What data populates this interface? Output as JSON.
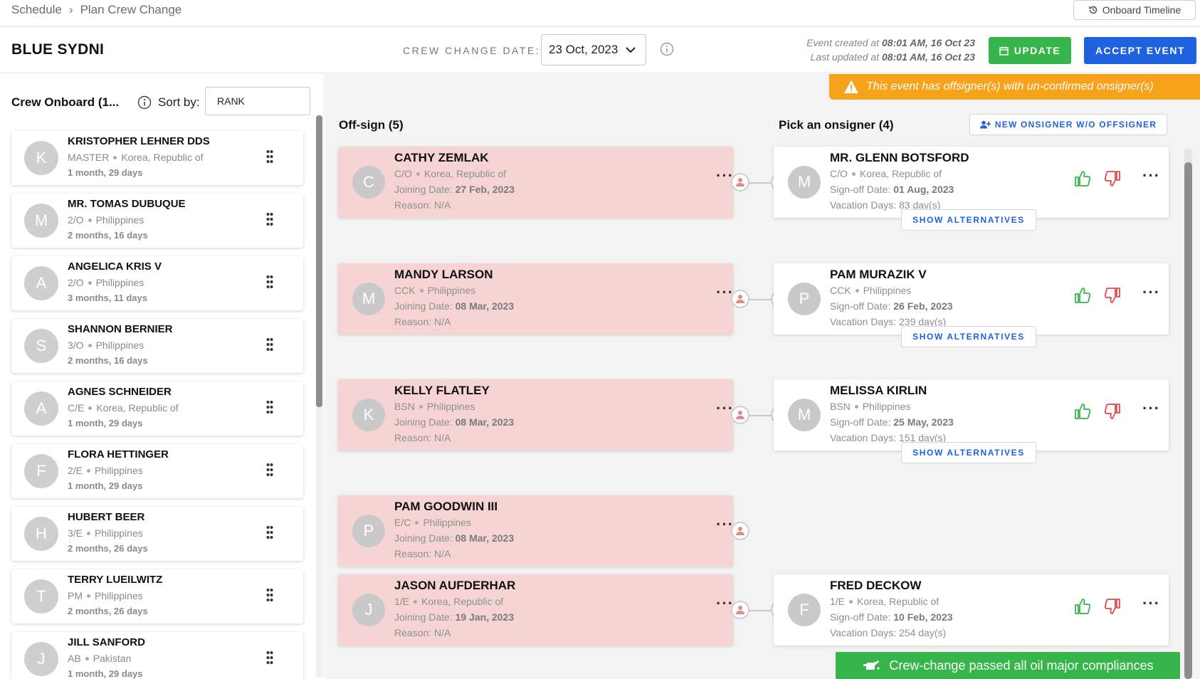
{
  "breadcrumb": {
    "root": "Schedule",
    "current": "Plan Crew Change"
  },
  "onboard_timeline_label": "Onboard Timeline",
  "header": {
    "ship_name": "BLUE SYDNI",
    "crew_change_date_label": "CREW CHANGE DATE:",
    "crew_change_date": "23 Oct, 2023",
    "event_created_prefix": "Event created at ",
    "event_created": "08:01 AM, 16 Oct 23",
    "last_updated_prefix": "Last updated at ",
    "last_updated": "08:01 AM, 16 Oct 23",
    "update_label": "UPDATE",
    "accept_label": "ACCEPT EVENT"
  },
  "sidebar": {
    "title": "Crew Onboard (1...",
    "sort_label": "Sort by:",
    "sort_value": "RANK",
    "crew": [
      {
        "initial": "K",
        "name": "KRISTOPHER LEHNER DDS",
        "rank": "MASTER",
        "country": "Korea, Republic of",
        "duration": "1 month, 29 days"
      },
      {
        "initial": "M",
        "name": "MR. TOMAS DUBUQUE",
        "rank": "2/O",
        "country": "Philippines",
        "duration": "2 months, 16 days"
      },
      {
        "initial": "A",
        "name": "ANGELICA KRIS V",
        "rank": "2/O",
        "country": "Philippines",
        "duration": "3 months, 11 days"
      },
      {
        "initial": "S",
        "name": "SHANNON BERNIER",
        "rank": "3/O",
        "country": "Philippines",
        "duration": "2 months, 16 days"
      },
      {
        "initial": "A",
        "name": "AGNES SCHNEIDER",
        "rank": "C/E",
        "country": "Korea, Republic of",
        "duration": "1 month, 29 days"
      },
      {
        "initial": "F",
        "name": "FLORA HETTINGER",
        "rank": "2/E",
        "country": "Philippines",
        "duration": "1 month, 29 days"
      },
      {
        "initial": "H",
        "name": "HUBERT BEER",
        "rank": "3/E",
        "country": "Philippines",
        "duration": "2 months, 26 days"
      },
      {
        "initial": "T",
        "name": "TERRY LUEILWITZ",
        "rank": "PM",
        "country": "Philippines",
        "duration": "2 months, 26 days"
      },
      {
        "initial": "J",
        "name": "JILL SANFORD",
        "rank": "AB",
        "country": "Pakistan",
        "duration": "1 month, 29 days"
      }
    ]
  },
  "warning_text": "This event has offsigner(s) with un-confirmed onsigner(s)",
  "offsign": {
    "title": "Off-sign (5)",
    "joining_label": "Joining Date: ",
    "reason_label": "Reason: ",
    "items": [
      {
        "initial": "C",
        "name": "CATHY ZEMLAK",
        "rank": "C/O",
        "country": "Korea, Republic of",
        "joining_date": "27 Feb, 2023",
        "reason": "N/A"
      },
      {
        "initial": "M",
        "name": "MANDY LARSON",
        "rank": "CCK",
        "country": "Philippines",
        "joining_date": "08 Mar, 2023",
        "reason": "N/A"
      },
      {
        "initial": "K",
        "name": "KELLY FLATLEY",
        "rank": "BSN",
        "country": "Philippines",
        "joining_date": "08 Mar, 2023",
        "reason": "N/A"
      },
      {
        "initial": "P",
        "name": "PAM GOODWIN III",
        "rank": "E/C",
        "country": "Philippines",
        "joining_date": "08 Mar, 2023",
        "reason": "N/A"
      },
      {
        "initial": "J",
        "name": "JASON AUFDERHAR",
        "rank": "1/E",
        "country": "Korea, Republic of",
        "joining_date": "19 Jan, 2023",
        "reason": "N/A"
      }
    ]
  },
  "onsign": {
    "title": "Pick an onsigner (4)",
    "new_onsigner_label": "NEW ONSIGNER W/O OFFSIGNER",
    "signoff_label": "Sign-off Date: ",
    "vacation_label": "Vacation Days: ",
    "show_alternatives_label": "SHOW ALTERNATIVES",
    "items": [
      {
        "initial": "M",
        "name": "MR. GLENN BOTSFORD",
        "rank": "C/O",
        "country": "Korea, Republic of",
        "signoff_date": "01 Aug, 2023",
        "vacation_days": "83 day(s)"
      },
      {
        "initial": "P",
        "name": "PAM MURAZIK V",
        "rank": "CCK",
        "country": "Philippines",
        "signoff_date": "26 Feb, 2023",
        "vacation_days": "239 day(s)"
      },
      {
        "initial": "M",
        "name": "MELISSA KIRLIN",
        "rank": "BSN",
        "country": "Philippines",
        "signoff_date": "25 May, 2023",
        "vacation_days": "151 day(s)"
      },
      {
        "initial": "F",
        "name": "FRED DECKOW",
        "rank": "1/E",
        "country": "Korea, Republic of",
        "signoff_date": "10 Feb, 2023",
        "vacation_days": "254 day(s)"
      }
    ]
  },
  "compliance_text": "Crew-change passed all oil major compliances",
  "colors": {
    "accent_blue": "#1e62e0",
    "green": "#35b54a",
    "warning": "#f7a21b",
    "offsign_bg": "#f6d4d4",
    "thumb_up": "#35b54a",
    "thumb_down": "#e04848"
  }
}
